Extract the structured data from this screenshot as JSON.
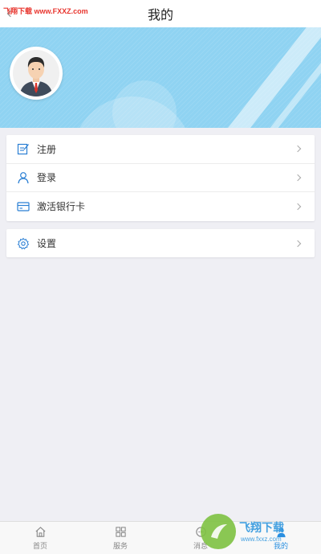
{
  "header": {
    "title": "我的",
    "watermark": "飞翔下载 www.FXXZ.com",
    "back_icon": "back-arrow-icon"
  },
  "profile": {
    "avatar_icon": "user-avatar-icon"
  },
  "menu": {
    "group1": [
      {
        "label": "注册",
        "icon": "edit-icon"
      },
      {
        "label": "登录",
        "icon": "person-icon"
      },
      {
        "label": "激活银行卡",
        "icon": "bank-card-icon"
      }
    ],
    "group2": [
      {
        "label": "设置",
        "icon": "gear-icon"
      }
    ]
  },
  "tabbar": {
    "items": [
      {
        "label": "首页",
        "icon": "home-icon"
      },
      {
        "label": "服务",
        "icon": "grid-icon"
      },
      {
        "label": "消息",
        "icon": "message-icon"
      },
      {
        "label": "我的",
        "icon": "profile-icon",
        "active": true
      }
    ]
  },
  "watermark_bottom": {
    "brand": "飞翔下载",
    "url": "www.fxxz.com"
  },
  "colors": {
    "banner": "#8fd3f2",
    "accent_icon": "#2a7fd4",
    "background": "#efeff4",
    "tab_active": "#2a8fe0"
  }
}
